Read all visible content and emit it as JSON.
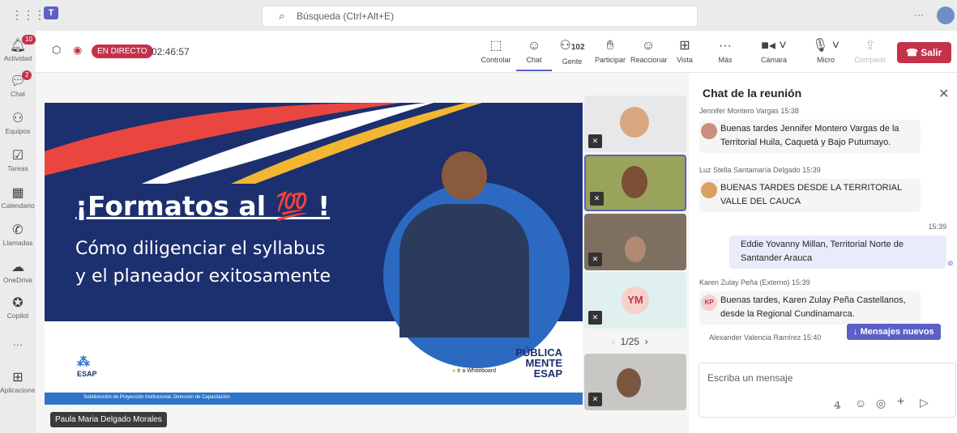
{
  "topbar": {
    "search_placeholder": "Búsqueda (Ctrl+Alt+E)",
    "more": "···"
  },
  "rail": [
    {
      "label": "Actividad",
      "badge": "10",
      "icon": "bell-icon"
    },
    {
      "label": "Chat",
      "badge": "2",
      "icon": "chat-icon"
    },
    {
      "label": "Equipos",
      "icon": "teams-icon"
    },
    {
      "label": "Tareas",
      "icon": "tasks-icon"
    },
    {
      "label": "Calendario",
      "icon": "calendar-icon"
    },
    {
      "label": "Llamadas",
      "icon": "phone-icon"
    },
    {
      "label": "OneDrive",
      "icon": "cloud-icon"
    },
    {
      "label": "Copilot",
      "icon": "copilot-icon"
    },
    {
      "label": "···",
      "icon": "more-icon"
    },
    {
      "label": "Aplicaciones",
      "icon": "apps-icon"
    }
  ],
  "meeting": {
    "live": "EN DIRECTO",
    "timer": "02:46:57",
    "people_count": "102",
    "leave": "Salir"
  },
  "toolbar": [
    "Controlar",
    "Chat",
    "Gente",
    "Participar",
    "Reaccionar",
    "Vista",
    "Más",
    "Cámara",
    "Micro",
    "Compartir"
  ],
  "slide": {
    "title": "¡Formatos al 💯 !",
    "subtitle_1": "Cómo diligenciar el syllabus",
    "subtitle_2": "y el planeador exitosamente",
    "brand": "PÚBLICA MENTE ESAP",
    "whiteboard": "Ir a Whiteboard",
    "footer": "Subdirección de Proyección Institucional, Dirección de Capacitación",
    "logo": "ESAP"
  },
  "presenter": "Paula Maria Delgado Morales",
  "tiles": {
    "initials": "YM",
    "pager": "1/25"
  },
  "chat": {
    "title": "Chat de la reunión",
    "messages": [
      {
        "meta": "Jennifer Montero Vargas  15:38",
        "text": "Buenas tardes Jennifer Montero Vargas de la Territorial Huila, Caquetá y Bajo Putumayo."
      },
      {
        "meta": "Luz Stella Santamaría Delgado  15:39",
        "text": "BUENAS TARDES DESDE LA TERRITORIAL VALLE DEL CAUCA"
      },
      {
        "meta": "15:39",
        "text": "Eddie Yovanny Millan, Territorial Norte de Santander Arauca"
      },
      {
        "meta": "Karen Zulay Peña (Externo)  15:39",
        "initials": "KP",
        "text": "Buenas tardes, Karen Zulay Peña Castellanos, desde la Regional Cundinamarca."
      },
      {
        "meta": "Alexander Valencia Ramírez  15:40",
        "text": ""
      }
    ],
    "new_messages": "Mensajes nuevos",
    "compose_placeholder": "Escriba un mensaje"
  }
}
